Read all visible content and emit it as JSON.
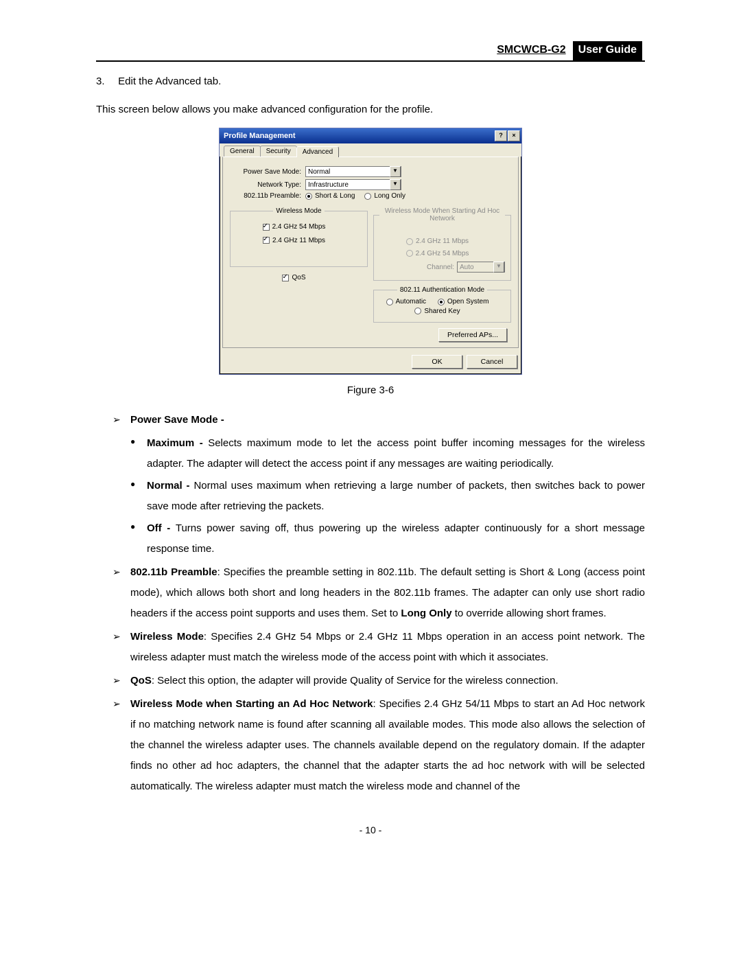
{
  "header": {
    "model": "SMCWCB-G2",
    "title": "User  Guide"
  },
  "step": {
    "num": "3.",
    "text": "Edit the Advanced tab."
  },
  "intro": "This screen below allows you make advanced configuration for the profile.",
  "figure_caption": "Figure 3-6",
  "page_number": "- 10 -",
  "bullets": {
    "psm_heading": "Power Save Mode -",
    "psm_max_label": "Maximum - ",
    "psm_max_text": "Selects maximum mode to let the access point buffer incoming messages for the wireless adapter. The adapter will detect the access point if any messages are waiting periodically.",
    "psm_norm_label": "Normal - ",
    "psm_norm_text": "Normal uses maximum when retrieving a large number of packets, then switches back to power save mode after retrieving the packets.",
    "psm_off_label": "Off - ",
    "psm_off_text": "Turns power saving off, thus powering up the wireless adapter continuously for a short message response time.",
    "preamble_label": "802.11b Preamble",
    "preamble_text_a": ": Specifies the preamble setting in 802.11b. The default setting is Short & Long (access point mode), which allows both short and long headers in the 802.11b frames. The adapter can only use short radio headers if the access point supports and uses them. Set to ",
    "preamble_bold": "Long Only",
    "preamble_text_b": " to override allowing short frames.",
    "wm_label": "Wireless Mode",
    "wm_text": ": Specifies 2.4 GHz 54 Mbps or 2.4 GHz 11 Mbps operation in an access point network. The wireless adapter must match the wireless mode of the access point with which it associates.",
    "qos_label": "QoS",
    "qos_text": ": Select this option, the adapter will provide Quality of Service for the wireless connection.",
    "adhoc_label": "Wireless Mode when Starting an Ad Hoc Network",
    "adhoc_text": ": Specifies 2.4 GHz 54/11 Mbps to start an Ad Hoc network if no matching network name is found after scanning all available modes. This mode also allows the selection of the channel the wireless adapter uses. The channels available depend on the regulatory domain. If the adapter finds no other ad hoc adapters, the channel that the adapter starts the ad hoc network with will be selected automatically. The wireless adapter must match the wireless mode and channel of the"
  },
  "dialog": {
    "title": "Profile Management",
    "help_btn": "?",
    "close_btn": "×",
    "tabs": {
      "general": "General",
      "security": "Security",
      "advanced": "Advanced"
    },
    "psm_label": "Power Save Mode:",
    "psm_value": "Normal",
    "nt_label": "Network Type:",
    "nt_value": "Infrastructure",
    "preamble_label": "802.11b Preamble:",
    "preamble_short_long": "Short & Long",
    "preamble_long_only": "Long Only",
    "wireless_mode_legend": "Wireless Mode",
    "wm_54": "2.4 GHz 54 Mbps",
    "wm_11": "2.4 GHz 11 Mbps",
    "qos": "QoS",
    "adhoc_legend": "Wireless Mode When Starting Ad Hoc Network",
    "adhoc_11": "2.4 GHz 11 Mbps",
    "adhoc_54": "2.4 GHz 54 Mbps",
    "channel_label": "Channel:",
    "channel_value": "Auto",
    "auth_legend": "802.11 Authentication Mode",
    "auth_auto": "Automatic",
    "auth_open": "Open System",
    "auth_shared": "Shared Key",
    "pref_ap": "Preferred APs...",
    "ok": "OK",
    "cancel": "Cancel"
  }
}
